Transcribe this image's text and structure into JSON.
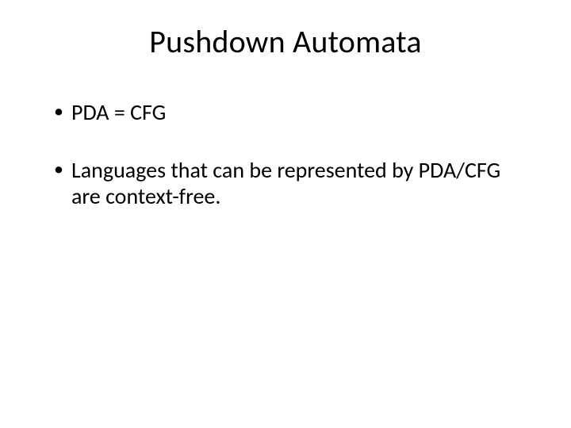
{
  "slide": {
    "title": "Pushdown Automata",
    "bullets": [
      "PDA = CFG",
      "Languages that can be represented by PDA/CFG are context-free."
    ]
  }
}
